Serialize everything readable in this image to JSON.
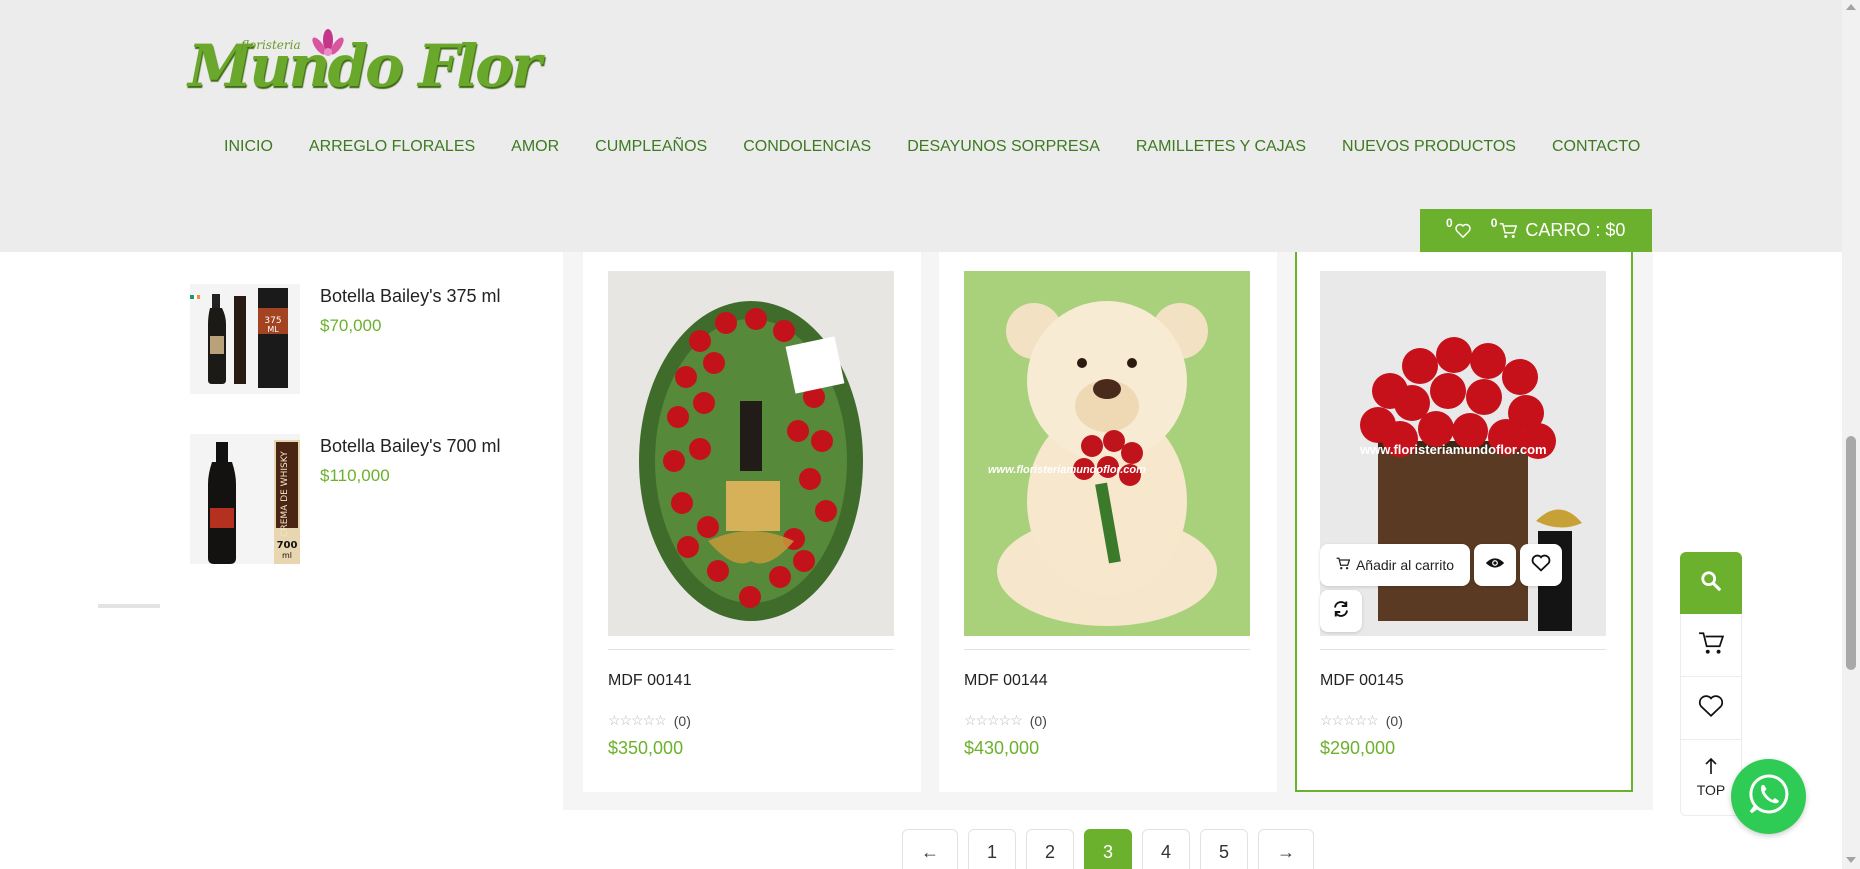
{
  "header": {
    "logo_small": "floristeria",
    "logo_main": "Mundo Flor",
    "nav": [
      "INICIO",
      "ARREGLO FLORALES",
      "AMOR",
      "CUMPLEAÑOS",
      "CONDOLENCIAS",
      "DESAYUNOS SORPRESA",
      "RAMILLETES Y CAJAS",
      "NUEVOS PRODUCTOS",
      "CONTACTO"
    ],
    "wishlist_count": "0",
    "cart_count": "0",
    "cart_label": "CARRO : $0"
  },
  "sidebar": {
    "products": [
      {
        "title": "Botella Bailey's 375 ml",
        "price": "$70,000"
      },
      {
        "title": "Botella Bailey's 700 ml",
        "price": "$110,000"
      }
    ]
  },
  "products": [
    {
      "name": "MDF 00141",
      "reviews": "(0)",
      "price": "$350,000"
    },
    {
      "name": "MDF 00144",
      "reviews": "(0)",
      "price": "$430,000"
    },
    {
      "name": "MDF 00145",
      "reviews": "(0)",
      "price": "$290,000",
      "add_to_cart": "Añadir al carrito",
      "watermark": "www.floristeriamundoflor.com"
    }
  ],
  "teddy_watermark": "www.floristeriamundoflor.com",
  "pagination": {
    "prev": "←",
    "pages": [
      "1",
      "2",
      "3",
      "4",
      "5"
    ],
    "current": "3",
    "next": "→"
  },
  "float": {
    "top_label": "TOP"
  },
  "colors": {
    "brand_green": "#6cb12d",
    "nav_green": "#3d7a20",
    "header_bg": "#ececec",
    "whatsapp": "#2ecc55"
  }
}
